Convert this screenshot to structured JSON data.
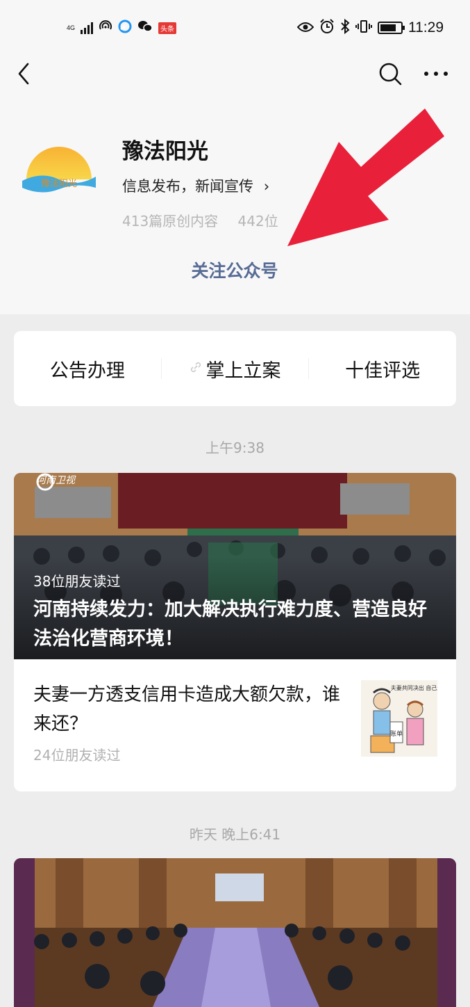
{
  "status_bar": {
    "network": "4G",
    "time": "11:29",
    "app_badge": "头条",
    "colors": {
      "icon": "#111111",
      "badge": "#e53935"
    }
  },
  "nav": {
    "back_icon": "chevron-left-icon",
    "search_icon": "search-icon",
    "more_icon": "more-dots-icon"
  },
  "account": {
    "name": "豫法阳光",
    "logo_text": "豫法阳光",
    "description": "信息发布，新闻宣传",
    "description_arrow": "›",
    "original_count": "413篇原创内容",
    "friends_following": "442位",
    "follow_label": "关注公众号",
    "accent_color": "#576b95"
  },
  "annotation": {
    "arrow_color": "#e8203a"
  },
  "menu": {
    "items": [
      {
        "label": "公告办理"
      },
      {
        "label": "掌上立案",
        "icon": "link-icon"
      },
      {
        "label": "十佳评选"
      }
    ]
  },
  "feed": {
    "groups": [
      {
        "time": "上午9:38",
        "main_article": {
          "source_logo": "河南卫视",
          "readers": "38位朋友读过",
          "title": "河南持续发力：加大解决执行难力度、营造良好法治化营商环境！"
        },
        "sub_article": {
          "title": "夫妻一方透支信用卡造成大额欠款，谁来还？",
          "readers": "24位朋友读过",
          "thumb_text": "夫妻共同决出 自己还",
          "thumb_label": "账单"
        }
      },
      {
        "time": "昨天 晚上6:41",
        "main_article": {}
      }
    ]
  }
}
